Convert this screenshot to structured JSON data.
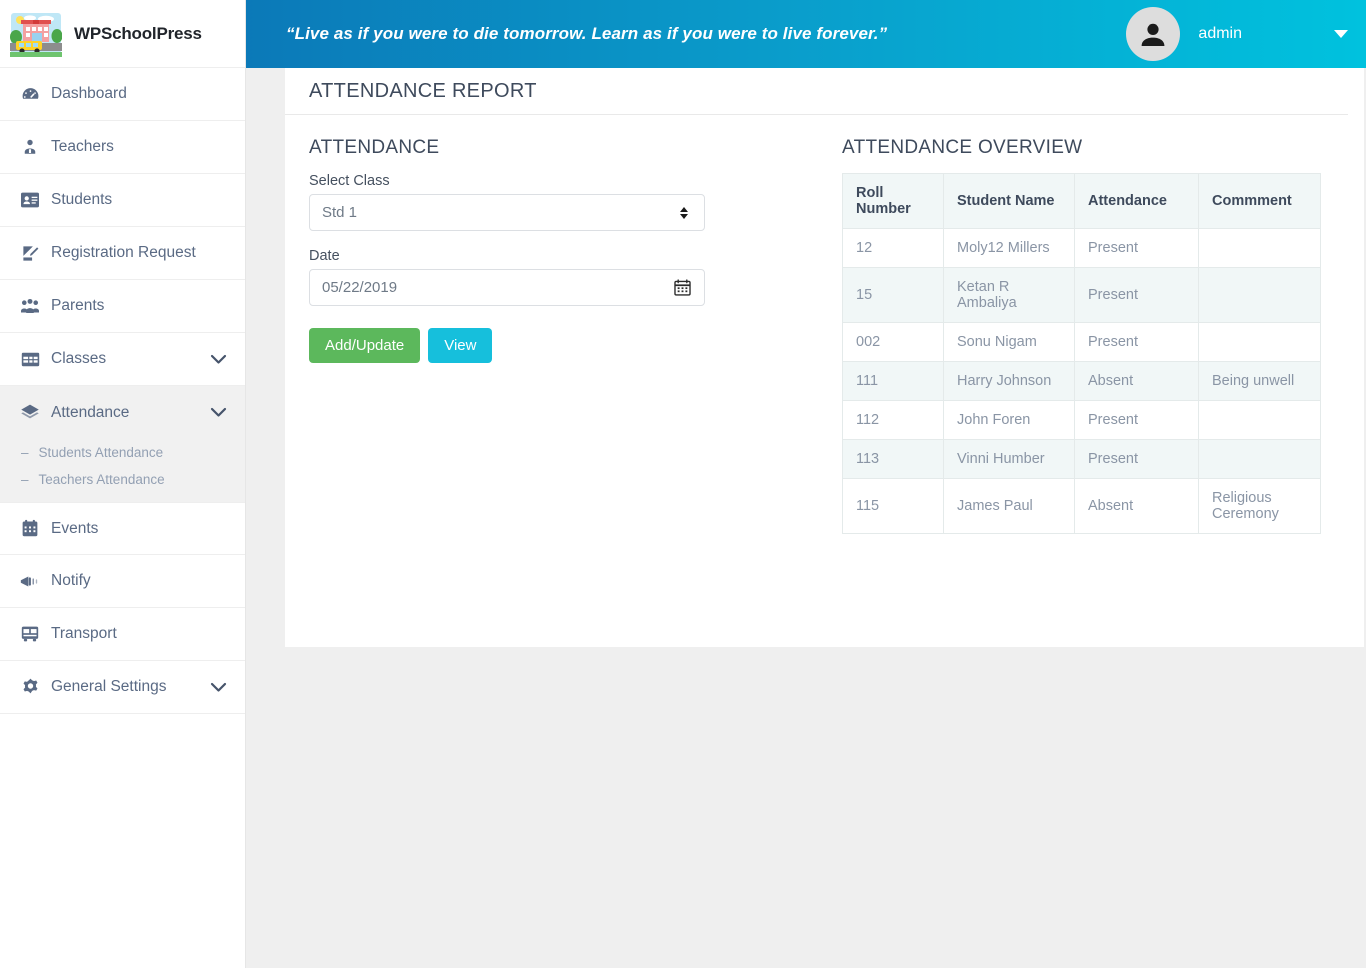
{
  "brand": {
    "title": "WPSchoolPress",
    "logo_icon": "school-building-bus-logo"
  },
  "header": {
    "quote": "“Live as if you were to die tomorrow. Learn as if you were to live forever.”",
    "user_name": "admin",
    "avatar_icon": "user-avatar-icon",
    "caret_icon": "caret-down-icon",
    "gradient_start": "#0b79b8",
    "gradient_end": "#00c2de"
  },
  "sidebar": {
    "items": [
      {
        "label": "Dashboard",
        "icon": "dashboard-icon",
        "expandable": false
      },
      {
        "label": "Teachers",
        "icon": "teacher-icon",
        "expandable": false
      },
      {
        "label": "Students",
        "icon": "id-card-icon",
        "expandable": false
      },
      {
        "label": "Registration Request",
        "icon": "edit-document-icon",
        "expandable": false
      },
      {
        "label": "Parents",
        "icon": "users-group-icon",
        "expandable": false
      },
      {
        "label": "Classes",
        "icon": "table-grid-icon",
        "expandable": true
      },
      {
        "label": "Attendance",
        "icon": "layers-icon",
        "expandable": true,
        "active": true
      },
      {
        "label": "Events",
        "icon": "calendar-icon",
        "expandable": false
      },
      {
        "label": "Notify",
        "icon": "megaphone-icon",
        "expandable": false
      },
      {
        "label": "Transport",
        "icon": "bus-icon",
        "expandable": false
      },
      {
        "label": "General Settings",
        "icon": "gear-icon",
        "expandable": true
      }
    ],
    "attendance_subitems": [
      {
        "label": "Students Attendance",
        "bullet": "–"
      },
      {
        "label": "Teachers Attendance",
        "bullet": "–"
      }
    ]
  },
  "main": {
    "page_title": "ATTENDANCE REPORT",
    "form": {
      "section_title": "ATTENDANCE",
      "class_label": "Select Class",
      "class_value": "Std 1",
      "date_label": "Date",
      "date_value": "05/22/2019",
      "date_icon": "calendar-icon",
      "select_icon": "updown-arrows-icon",
      "add_update_button": "Add/Update",
      "view_button": "View",
      "add_update_color": "#5cb85c",
      "view_color": "#16bfdc"
    },
    "overview": {
      "section_title": "ATTENDANCE OVERVIEW",
      "columns": [
        "Roll Number",
        "Student Name",
        "Attendance",
        "Commment"
      ],
      "rows": [
        {
          "roll": "12",
          "name": "Moly12 Millers",
          "attendance": "Present",
          "comment": ""
        },
        {
          "roll": "15",
          "name": "Ketan R Ambaliya",
          "attendance": "Present",
          "comment": ""
        },
        {
          "roll": "002",
          "name": "Sonu Nigam",
          "attendance": "Present",
          "comment": ""
        },
        {
          "roll": "111",
          "name": "Harry Johnson",
          "attendance": "Absent",
          "comment": "Being unwell"
        },
        {
          "roll": "112",
          "name": "John Foren",
          "attendance": "Present",
          "comment": ""
        },
        {
          "roll": "113",
          "name": "Vinni Humber",
          "attendance": "Present",
          "comment": ""
        },
        {
          "roll": "115",
          "name": "James Paul",
          "attendance": "Absent",
          "comment": "Religious Ceremony"
        }
      ]
    }
  }
}
